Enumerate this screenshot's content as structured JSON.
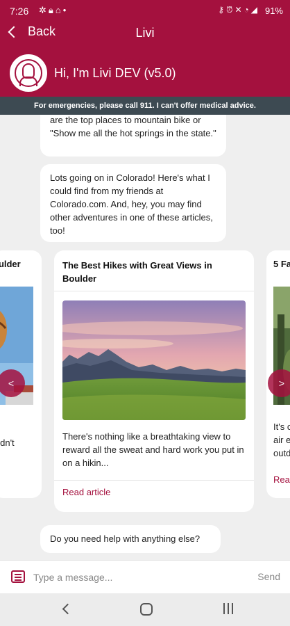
{
  "status_bar": {
    "time": "7:26",
    "left_icons": [
      "settings-gear-icon",
      "lock-icon",
      "home-icon",
      "dot-icon"
    ],
    "right_icons": [
      "key-icon",
      "alarm-icon",
      "mute-icon",
      "wifi-icon",
      "signal-icon"
    ],
    "battery": "91%"
  },
  "nav": {
    "back_label": "Back",
    "title": "Livi"
  },
  "bot": {
    "name": "Hi, I'm Livi DEV (v5.0)"
  },
  "notice": "For emergencies, please call 911. I can't offer medical advice.",
  "messages": [
    {
      "text": "are the top places to mountain bike or \"Show me all the hot springs in the state.\""
    },
    {
      "text": "Lots going on in Colorado! Here's what I could find from my friends at Colorado.com. And, hey, you may find other adventures in one of these articles, too!"
    },
    {
      "text": "Do you need help with anything else?"
    }
  ],
  "carousel": {
    "left_card": {
      "title": "oulder",
      "text": "e\n didn't"
    },
    "main_card": {
      "title": "The Best Hikes with Great Views in Boulder",
      "description": "There's nothing like a breathtaking view to reward all the sweat and hard work you put in on a hikin...",
      "link": "Read article"
    },
    "right_card": {
      "title": "5 Fa",
      "text": "It's c\nair e\noutd",
      "link": "Rea"
    },
    "prev_label": "<",
    "next_label": ">"
  },
  "input": {
    "placeholder": "Type a message...",
    "value": "",
    "send_label": "Send"
  },
  "colors": {
    "brand": "#a4113e",
    "notice_bg": "#3d4a52",
    "chat_bg": "#efefef"
  }
}
